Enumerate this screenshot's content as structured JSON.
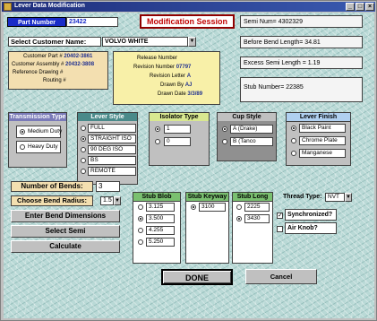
{
  "window": {
    "title": "Lever Data Modification"
  },
  "header": {
    "part_number_label": "Part Number",
    "part_number_value": "23422",
    "session_label": "Modification Session",
    "customer_label": "Select Customer Name:",
    "customer_value": "VOLVO WHITE"
  },
  "customer_info": {
    "part_label": "Customer Part #",
    "part_value": "20402-3861",
    "assembly_label": "Customer Assembly #",
    "assembly_value": "20432-3808",
    "drawing_label": "Reference Drawing #",
    "routing_label": "Routing #"
  },
  "release": {
    "release_label": "Release Number",
    "revision_number_label": "Revision Number",
    "revision_number_value": "07797",
    "revision_letter_label": "Revision Letter",
    "revision_letter_value": "A",
    "drawn_by_label": "Drawn By",
    "drawn_by_value": "AJ",
    "drawn_date_label": "Drawn Date",
    "drawn_date_value": "3/3/89"
  },
  "summary": {
    "semi_num": "Semi Num= 4302329",
    "before_bend": "Before Bend Length= 34.81",
    "excess_semi": "Excess Semi Length = 1.19",
    "stub_number": "Stub Number= 22385"
  },
  "transmission": {
    "title": "Transmission Type",
    "options": [
      "Medium Duty",
      "Heavy Duty"
    ],
    "selected": 0
  },
  "lever_style": {
    "title": "Lever Style",
    "options": [
      "FULL",
      "STRAIGHT ISO",
      "90 DEG ISO",
      "BS",
      "REMOTE"
    ],
    "selected": 1
  },
  "isolator": {
    "title": "Isolator Type",
    "options": [
      "1",
      "0"
    ],
    "selected": 0
  },
  "cup_style": {
    "title": "Cup Style",
    "options": [
      "A (Drake)",
      "B (Tanco"
    ],
    "selected": 0
  },
  "lever_finish": {
    "title": "Lever Finish",
    "options": [
      "Black Paint",
      "Chrome Plate",
      "Manganese"
    ],
    "selected": 0
  },
  "bends": {
    "number_label": "Number of Bends:",
    "number_value": "3",
    "radius_label": "Choose Bend Radius:",
    "radius_value": "1.5"
  },
  "buttons": {
    "enter_dimensions": "Enter Bend Dimensions",
    "select_semi": "Select Semi",
    "calculate": "Calculate",
    "done": "DONE",
    "cancel": "Cancel"
  },
  "stub_blob": {
    "title": "Stub Blob",
    "options": [
      "3.125",
      "3.500",
      "4.255",
      "5.250"
    ],
    "selected": 1
  },
  "stub_keyway": {
    "title": "Stub Keyway",
    "options": [
      "3100"
    ],
    "selected": 0
  },
  "stub_long": {
    "title": "Stub Long",
    "options": [
      "2225",
      "3430"
    ],
    "selected": 1
  },
  "thread": {
    "label": "Thread Type:",
    "value": "NVT",
    "synchronized_label": "Synchronized?",
    "synchronized_checked": true,
    "air_knob_label": "Air Knob?",
    "air_knob_checked": false
  },
  "colors": {
    "title_bar": "#1e2d7a",
    "part_label_bg": "#1a2cc8",
    "session_text": "#c00000",
    "info_panel_bg": "#f3dfb0",
    "release_panel_bg": "#f8f0a8",
    "transmission_header": "#7a7ab8",
    "lever_style_header": "#4a8a8a",
    "isolator_header": "#d8e890",
    "cup_style_header": "#8a8a8a",
    "lever_finish_header": "#b0d0f0",
    "stub_header": "#7ac070"
  }
}
